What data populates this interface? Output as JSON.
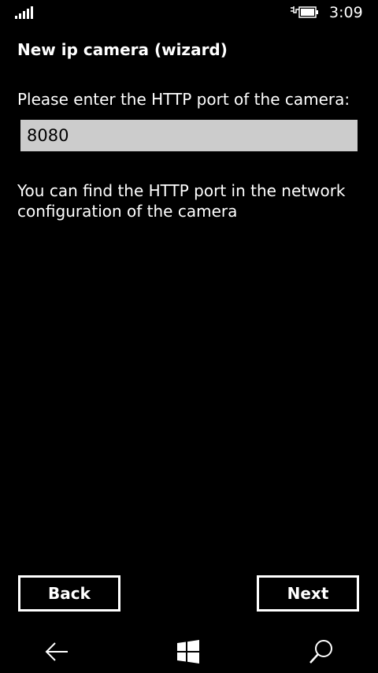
{
  "status_bar": {
    "signal_icon": "signal-strength-icon",
    "battery_icon": "battery-charging-icon",
    "time": "3:09"
  },
  "page": {
    "title": "New ip camera (wizard)",
    "prompt": "Please enter the HTTP port of the camera:",
    "port_value": "8080",
    "help_text": "You can find the HTTP port in the network configuration of the camera"
  },
  "buttons": {
    "back_label": "Back",
    "next_label": "Next"
  },
  "nav_bar": {
    "back_icon": "back-arrow-icon",
    "start_icon": "windows-start-icon",
    "search_icon": "search-icon"
  },
  "colors": {
    "background": "#000000",
    "foreground": "#ffffff",
    "input_background": "#cccccc"
  }
}
